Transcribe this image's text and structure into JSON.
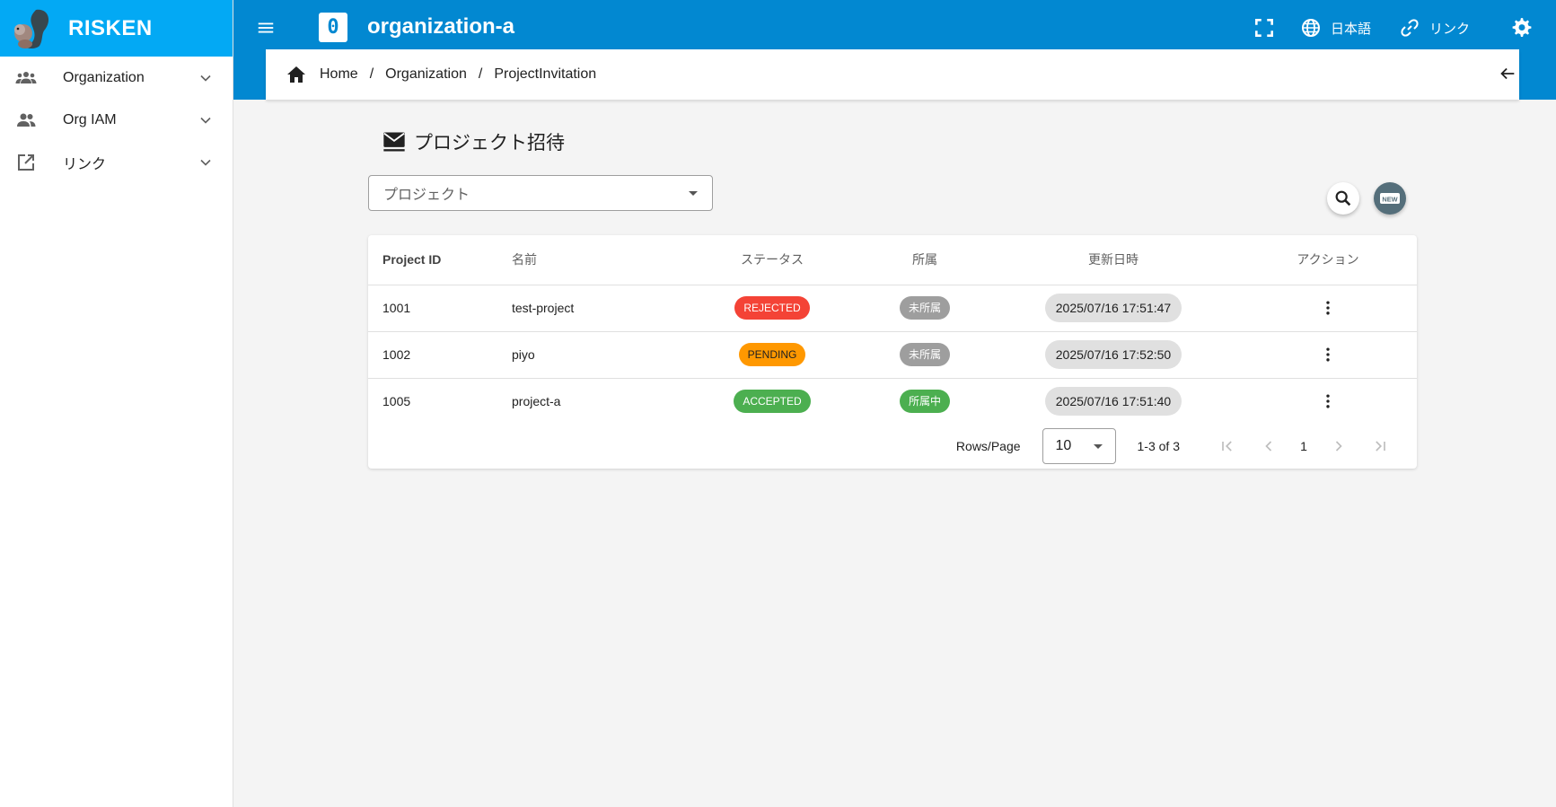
{
  "brand": {
    "name": "RISKEN",
    "logo_icon": "squirrel-logo-icon"
  },
  "sidebar": {
    "items": [
      {
        "label": "Organization",
        "icon": "group-icon"
      },
      {
        "label": "Org IAM",
        "icon": "people-icon"
      },
      {
        "label": "リンク",
        "icon": "open-in-new-icon"
      }
    ]
  },
  "topbar": {
    "org_initial": "0",
    "org_name": "organization-a",
    "language_label": "日本語",
    "link_label": "リンク"
  },
  "breadcrumb": {
    "items": [
      "Home",
      "Organization",
      "ProjectInvitation"
    ],
    "separator": "/"
  },
  "page": {
    "title": "プロジェクト招待",
    "project_select_placeholder": "プロジェクト",
    "new_button_label": "NEW"
  },
  "table": {
    "headers": [
      "Project ID",
      "名前",
      "ステータス",
      "所属",
      "更新日時",
      "アクション"
    ],
    "rows": [
      {
        "project_id": "1001",
        "name": "test-project",
        "status": "REJECTED",
        "affiliation": "未所属",
        "updated_at": "2025/07/16 17:51:47"
      },
      {
        "project_id": "1002",
        "name": "piyo",
        "status": "PENDING",
        "affiliation": "未所属",
        "updated_at": "2025/07/16 17:52:50"
      },
      {
        "project_id": "1005",
        "name": "project-a",
        "status": "ACCEPTED",
        "affiliation": "所属中",
        "updated_at": "2025/07/16 17:51:40"
      }
    ]
  },
  "pagination": {
    "rows_label": "Rows/Page",
    "rows_per_page": "10",
    "range": "1-3 of 3",
    "current_page": "1"
  },
  "colors": {
    "brand_bar": "#03a9f4",
    "topbar": "#0288d1",
    "rejected": "#f44336",
    "pending": "#ff9800",
    "accepted": "#4caf50",
    "unaffiliated": "#9e9e9e",
    "affiliated": "#4caf50"
  }
}
